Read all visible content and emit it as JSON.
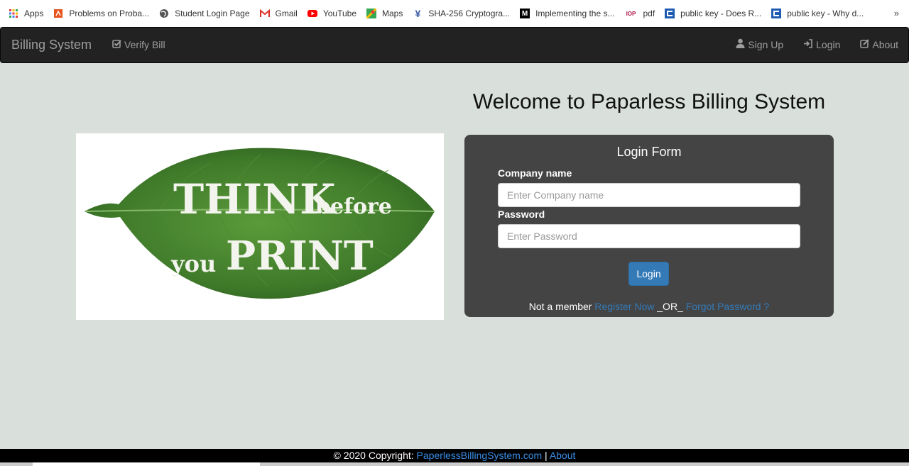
{
  "bookmarks": [
    {
      "label": "Apps",
      "icon": "apps-grid-icon",
      "color": "#e53935"
    },
    {
      "label": "Problems on Proba...",
      "icon": "bookmark-icon",
      "color": "#e8541c"
    },
    {
      "label": "Student Login Page",
      "icon": "globe-icon",
      "color": "#555555"
    },
    {
      "label": "Gmail",
      "icon": "gmail-icon",
      "color": "#d93025"
    },
    {
      "label": "YouTube",
      "icon": "youtube-icon",
      "color": "#ff0000"
    },
    {
      "label": "Maps",
      "icon": "maps-icon",
      "color": "#34a853"
    },
    {
      "label": "SHA-256 Cryptogra...",
      "icon": "bookmark-icon",
      "color": "#3b5ba5"
    },
    {
      "label": "Implementing the s...",
      "icon": "medium-icon",
      "color": "#000000"
    },
    {
      "label": "pdf",
      "icon": "iop-icon",
      "color": "#b0154a"
    },
    {
      "label": "public key - Does R...",
      "icon": "stackexchange-icon",
      "color": "#1e5cb3"
    },
    {
      "label": "public key - Why d...",
      "icon": "stackexchange-icon",
      "color": "#1e5cb3"
    }
  ],
  "bookmarks_more": "»",
  "navbar": {
    "brand": "Billing System",
    "verify_label": "Verify Bill",
    "signup_label": "Sign Up",
    "login_label": "Login",
    "about_label": "About"
  },
  "main": {
    "title": "Welcome to Paparless Billing System",
    "leaf_line1_big": "THINK",
    "leaf_line1_small": "before",
    "leaf_line2_small": "you",
    "leaf_line2_big": "PRINT"
  },
  "login_form": {
    "title": "Login Form",
    "company_label": "Company name",
    "company_placeholder": "Enter Company name",
    "company_value": "",
    "password_label": "Password",
    "password_placeholder": "Enter Password",
    "password_value": "",
    "submit_label": "Login",
    "not_member_text": "Not a member",
    "register_link": "Register Now",
    "or_text": "_OR_",
    "forgot_link": "Forgot Password ?"
  },
  "footer": {
    "copyright": "© 2020 Copyright:",
    "site_link": "PaperlessBillingSystem.com",
    "separator": "|",
    "about_link": "About"
  },
  "colors": {
    "page_bg": "#d9e0db",
    "navbar_bg": "#222222",
    "panel_bg": "#444444",
    "link": "#337ab7",
    "button": "#337ab7",
    "leaf": "#3f7a2a"
  }
}
